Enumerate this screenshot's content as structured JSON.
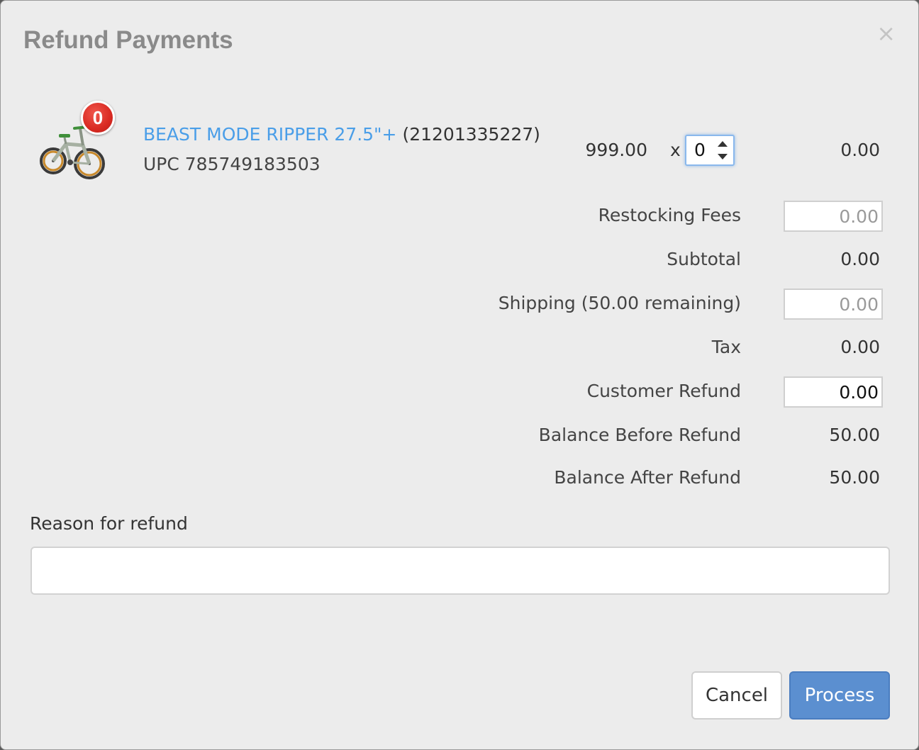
{
  "dialog": {
    "title": "Refund Payments",
    "close_glyph": "×"
  },
  "product": {
    "icon": "bicycle-image",
    "badge_count": "0",
    "name": "BEAST MODE RIPPER 27.5\"+",
    "id": "(21201335227)",
    "upc": "UPC 785749183503",
    "unit_price": "999.00",
    "times": "x",
    "quantity": "0",
    "line_total": "0.00"
  },
  "summary": {
    "restocking_fees": {
      "label": "Restocking Fees",
      "value": "",
      "placeholder": "0.00"
    },
    "subtotal": {
      "label": "Subtotal",
      "value": "0.00"
    },
    "shipping": {
      "label": "Shipping (50.00 remaining)",
      "value": "",
      "placeholder": "0.00"
    },
    "tax": {
      "label": "Tax",
      "value": "0.00"
    },
    "customer_refund": {
      "label": "Customer Refund",
      "value": "0.00"
    },
    "balance_before": {
      "label": "Balance Before Refund",
      "value": "50.00"
    },
    "balance_after": {
      "label": "Balance After Refund",
      "value": "50.00"
    }
  },
  "reason": {
    "label": "Reason for refund",
    "value": ""
  },
  "buttons": {
    "cancel": "Cancel",
    "process": "Process"
  },
  "colors": {
    "link": "#4a9ee8",
    "primary": "#5b8fd0",
    "badge": "#d92a22",
    "background": "#ececec"
  }
}
